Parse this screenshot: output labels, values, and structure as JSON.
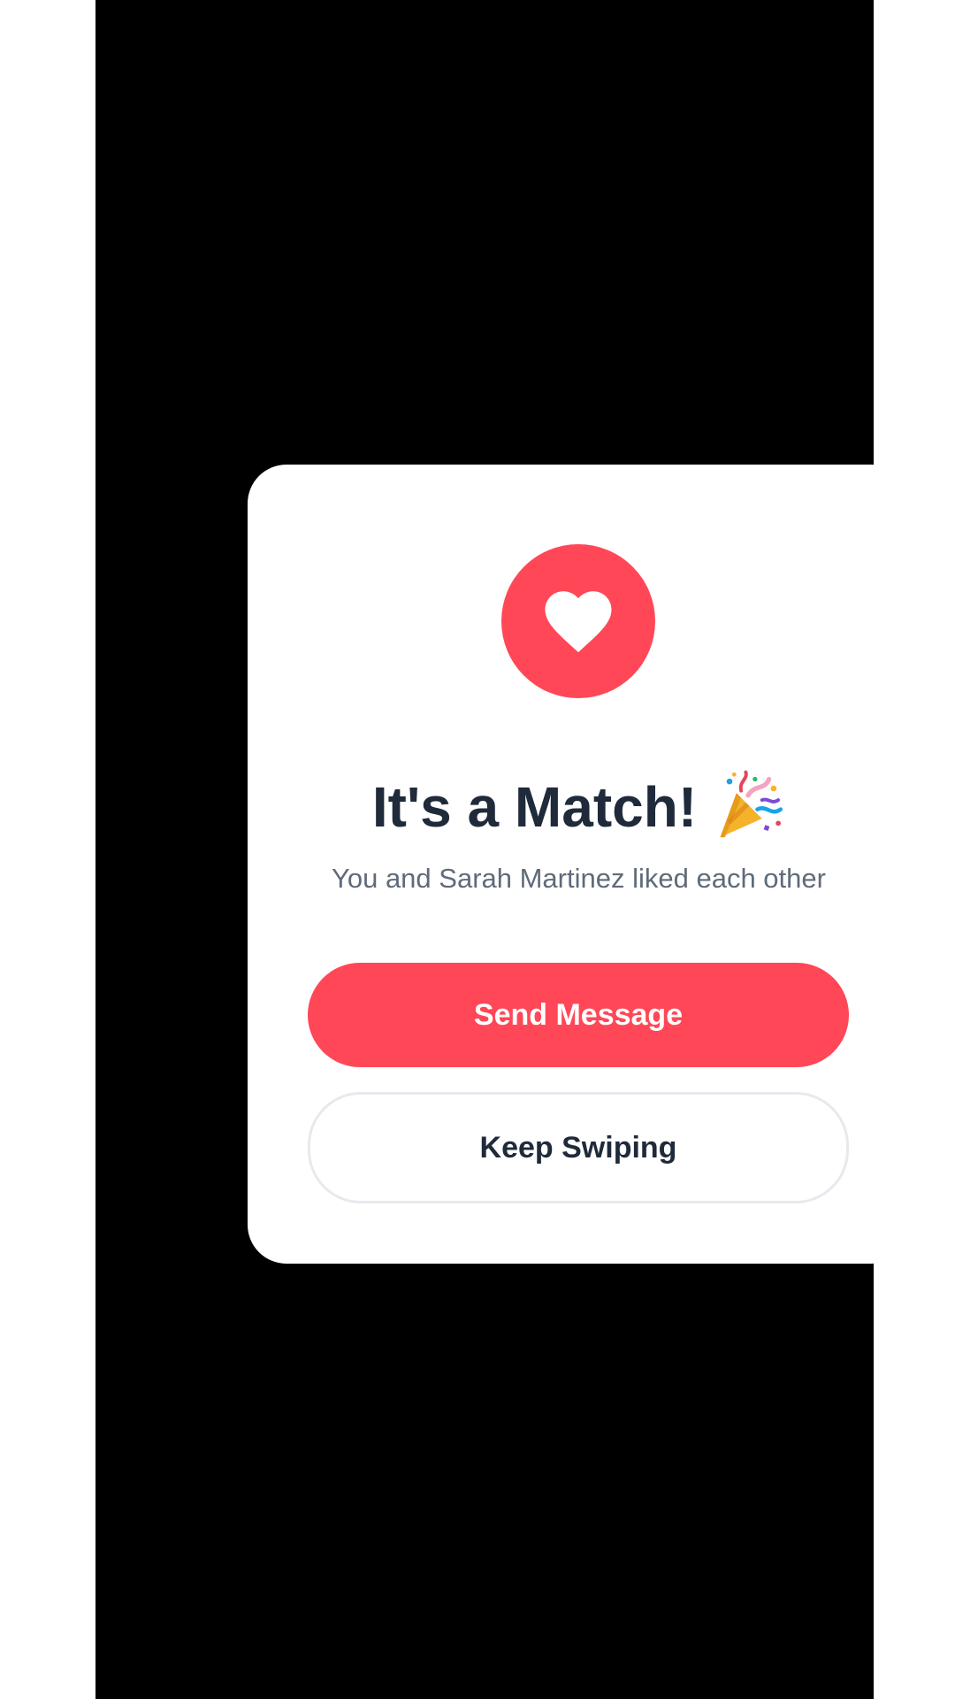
{
  "colors": {
    "accent": "#ff4757",
    "backdrop": "#000000",
    "title_text": "#1f2a3a",
    "subtitle_text": "#5f6b7a"
  },
  "modal": {
    "icon": "heart-icon",
    "title": "It's a Match!",
    "title_emoji_icon": "party-popper-icon",
    "subtitle": "You and Sarah Martinez liked each other",
    "primary_button_label": "Send Message",
    "secondary_button_label": "Keep Swiping"
  }
}
